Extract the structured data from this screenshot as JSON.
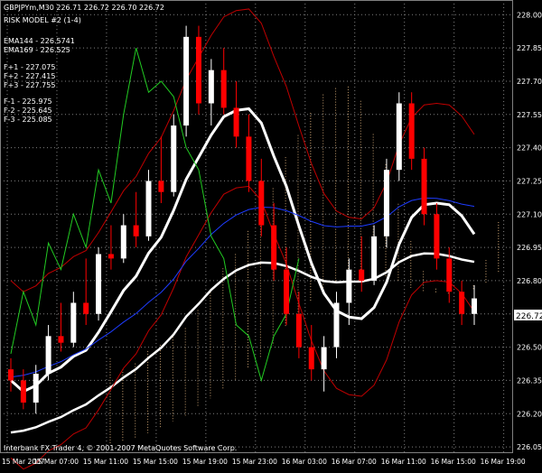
{
  "window": {
    "symbol_line": "GBPJPYm,M30  226.71 226.72 226.70 226.72",
    "footer": "Interbank FX Trader 4, © 2001-2007 MetaQuotes Software Corp.",
    "current_price_label": "226.72"
  },
  "indicators": {
    "risk_model": "RISK MODEL #2 (1-4)",
    "ema144": "EMA144 - 226.5741",
    "ema169": "EMA169 - 226.525",
    "fib_plus": [
      "F+1 - 227.075",
      "F+2 - 227.415",
      "F+3 - 227.755"
    ],
    "fib_minus": [
      "F-1 - 225.975",
      "F-2 - 225.645",
      "F-3 - 225.085"
    ]
  },
  "colors": {
    "background": "#000000",
    "grid": "#808080",
    "bull_candle": "#ffffff",
    "bear_candle": "#ff0000",
    "ma_white": "#ffffff",
    "red_line": "#c00000",
    "blue_line": "#1e3cff",
    "green_line": "#22cc22",
    "cloud": "#c8a070"
  },
  "chart_data": {
    "type": "line",
    "title": "GBPJPYm,M30",
    "y_ticks": [
      "228.00",
      "227.85",
      "227.70",
      "227.55",
      "227.40",
      "227.25",
      "227.10",
      "226.95",
      "226.80",
      "226.65",
      "226.50",
      "226.35",
      "226.20",
      "226.05"
    ],
    "x_ticks": [
      "15 Mar 2007",
      "15 Mar 07:00",
      "15 Mar 11:00",
      "15 Mar 15:00",
      "15 Mar 19:00",
      "15 Mar 23:00",
      "16 Mar 03:00",
      "16 Mar 07:00",
      "16 Mar 11:00",
      "16 Mar 15:00",
      "16 Mar 19:00"
    ],
    "ylim": [
      226.03,
      228.05
    ],
    "current_price": 226.72,
    "candles": [
      [
        226.4,
        226.45,
        226.3,
        226.35
      ],
      [
        226.35,
        226.4,
        226.22,
        226.25
      ],
      [
        226.25,
        226.42,
        226.2,
        226.38
      ],
      [
        226.38,
        226.6,
        226.35,
        226.55
      ],
      [
        226.55,
        226.7,
        226.48,
        226.52
      ],
      [
        226.52,
        226.75,
        226.5,
        226.7
      ],
      [
        226.7,
        226.9,
        226.6,
        226.65
      ],
      [
        226.65,
        226.95,
        226.62,
        226.92
      ],
      [
        226.92,
        227.05,
        226.85,
        226.9
      ],
      [
        226.9,
        227.1,
        226.88,
        227.05
      ],
      [
        227.05,
        227.2,
        226.95,
        227.0
      ],
      [
        227.0,
        227.3,
        226.98,
        227.25
      ],
      [
        227.25,
        227.45,
        227.15,
        227.2
      ],
      [
        227.2,
        227.55,
        227.18,
        227.5
      ],
      [
        227.5,
        227.95,
        227.45,
        227.9
      ],
      [
        227.9,
        227.95,
        227.55,
        227.6
      ],
      [
        227.6,
        227.8,
        227.5,
        227.75
      ],
      [
        227.75,
        227.85,
        227.55,
        227.58
      ],
      [
        227.58,
        227.7,
        227.4,
        227.45
      ],
      [
        227.45,
        227.55,
        227.2,
        227.25
      ],
      [
        227.25,
        227.35,
        227.0,
        227.05
      ],
      [
        227.05,
        227.15,
        226.8,
        226.85
      ],
      [
        226.85,
        226.95,
        226.6,
        226.65
      ],
      [
        226.65,
        226.75,
        226.45,
        226.5
      ],
      [
        226.5,
        226.6,
        226.35,
        226.4
      ],
      [
        226.4,
        226.55,
        226.3,
        226.5
      ],
      [
        226.5,
        226.75,
        226.45,
        226.7
      ],
      [
        226.7,
        226.9,
        226.6,
        226.85
      ],
      [
        226.85,
        227.0,
        226.75,
        226.8
      ],
      [
        226.8,
        227.05,
        226.78,
        227.0
      ],
      [
        227.0,
        227.35,
        226.95,
        227.3
      ],
      [
        227.3,
        227.65,
        227.25,
        227.6
      ],
      [
        227.6,
        227.65,
        227.3,
        227.35
      ],
      [
        227.35,
        227.4,
        227.05,
        227.1
      ],
      [
        227.1,
        227.15,
        226.85,
        226.9
      ],
      [
        226.9,
        226.95,
        226.7,
        226.75
      ],
      [
        226.75,
        226.8,
        226.6,
        226.65
      ],
      [
        226.65,
        226.78,
        226.6,
        226.72
      ]
    ]
  }
}
